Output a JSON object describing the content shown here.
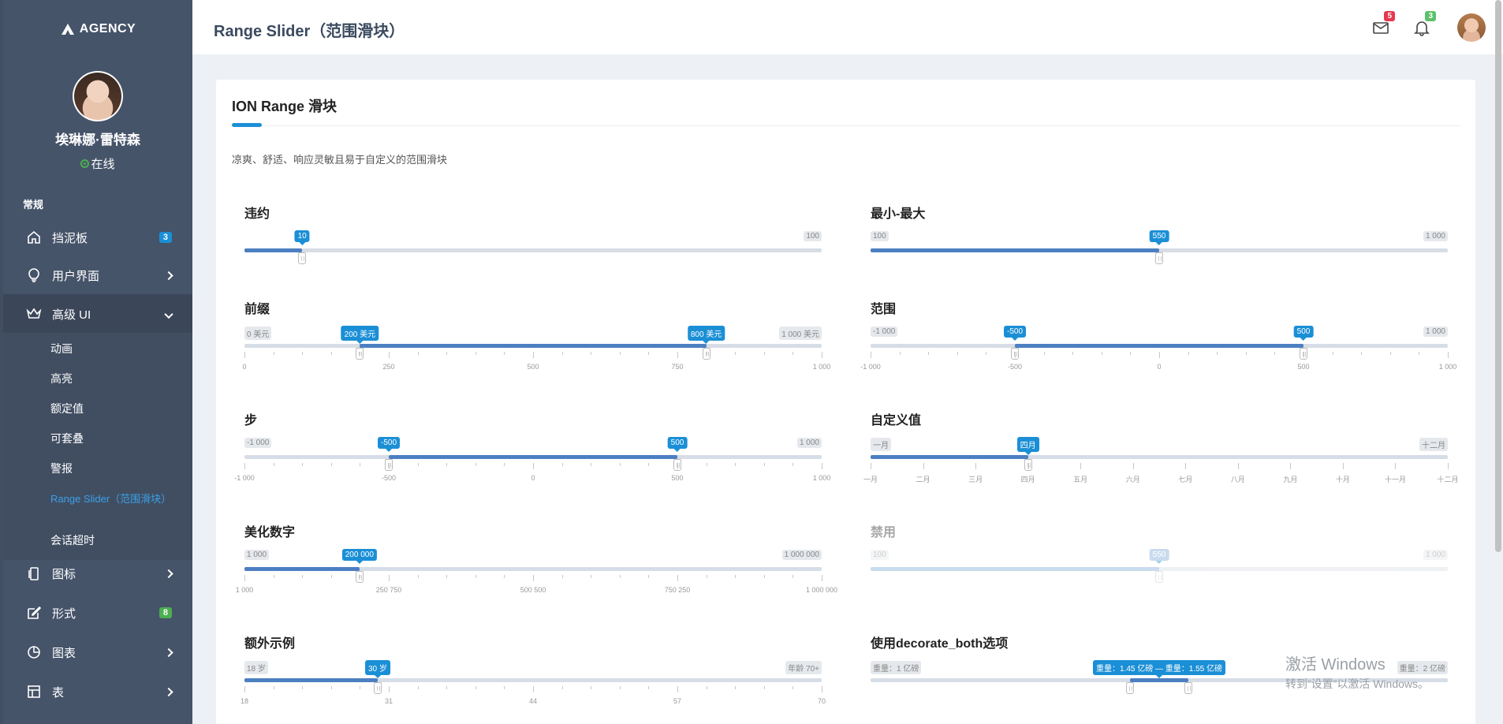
{
  "sidebar": {
    "logo": "AGENCY",
    "user_name": "埃琳娜·雷特森",
    "user_status": "在线",
    "section_general": "常规",
    "items": [
      {
        "label": "挡泥板",
        "badge": "3",
        "badge_color": "#1b8fd6"
      },
      {
        "label": "用户界面"
      },
      {
        "label": "高级 UI"
      },
      {
        "label": "图标"
      },
      {
        "label": "形式",
        "badge": "8",
        "badge_color": "#4caf50"
      },
      {
        "label": "图表"
      },
      {
        "label": "表"
      }
    ],
    "sub_items": [
      "动画",
      "高亮",
      "额定值",
      "可套叠",
      "警报",
      "Range Slider（范围滑块）",
      "会话超时"
    ]
  },
  "header": {
    "title": "Range Slider（范围滑块）",
    "mail_badge": "5",
    "bell_badge": "3"
  },
  "card": {
    "title": "ION Range 滑块",
    "description": "凉爽、舒适、响应灵敏且易于自定义的范围滑块"
  },
  "sliders": [
    {
      "title": "违约",
      "min_label": "",
      "max_label": "100",
      "values": [
        10
      ],
      "from_label": "10",
      "min": 0,
      "max": 100,
      "ticks": [],
      "tick_labels": []
    },
    {
      "title": "最小-最大",
      "min_label": "100",
      "max_label": "1 000",
      "values": [
        550
      ],
      "from_label": "550",
      "min": 100,
      "max": 1000,
      "ticks": [],
      "tick_labels": []
    },
    {
      "title": "前缀",
      "min_label": "0 美元",
      "max_label": "1 000 美元",
      "values": [
        200,
        800
      ],
      "from_label": "200 美元",
      "to_label": "800 美元",
      "min": 0,
      "max": 1000,
      "tick_labels": [
        "0",
        "250",
        "500",
        "750",
        "1 000"
      ]
    },
    {
      "title": "范围",
      "min_label": "-1 000",
      "max_label": "1 000",
      "values": [
        -500,
        500
      ],
      "from_label": "-500",
      "to_label": "500",
      "min": -1000,
      "max": 1000,
      "tick_labels": [
        "-1 000",
        "-500",
        "0",
        "500",
        "1 000"
      ]
    },
    {
      "title": "步",
      "min_label": "-1 000",
      "max_label": "1 000",
      "values": [
        -500,
        500
      ],
      "from_label": "-500",
      "to_label": "500",
      "min": -1000,
      "max": 1000,
      "tick_labels": [
        "-1 000",
        "-500",
        "0",
        "500",
        "1 000"
      ]
    },
    {
      "title": "自定义值",
      "min_label": "一月",
      "max_label": "十二月",
      "values": [
        3
      ],
      "from_label": "四月",
      "min": 0,
      "max": 11,
      "tick_labels": [
        "一月",
        "二月",
        "三月",
        "四月",
        "五月",
        "六月",
        "七月",
        "八月",
        "九月",
        "十月",
        "十一月",
        "十二月"
      ]
    },
    {
      "title": "美化数字",
      "min_label": "1 000",
      "max_label": "1 000 000",
      "values": [
        200000
      ],
      "from_label": "200 000",
      "min": 1000,
      "max": 1000000,
      "tick_labels": [
        "1 000",
        "250 750",
        "500 500",
        "750 250",
        "1 000 000"
      ]
    },
    {
      "title": "禁用",
      "min_label": "100",
      "max_label": "1 000",
      "values": [
        550
      ],
      "from_label": "550",
      "min": 100,
      "max": 1000,
      "tick_labels": [],
      "disabled": true
    },
    {
      "title": "额外示例",
      "min_label": "18 岁",
      "max_label": "年龄 70+",
      "values": [
        30
      ],
      "from_label": "30 岁",
      "min": 18,
      "max": 70,
      "tick_labels": [
        "18",
        "31",
        "44",
        "57",
        "70"
      ]
    },
    {
      "title": "使用decorate_both选项",
      "min_label": "重量：1 亿磅",
      "max_label": "重量：2 亿磅",
      "values": [
        1.45,
        1.55
      ],
      "from_label": "重量：1.45 亿磅 — 重量：1.55 亿磅",
      "combined": true,
      "min": 1,
      "max": 2,
      "tick_labels": []
    }
  ],
  "watermark": {
    "line1": "激活 Windows",
    "line2": "转到“设置”以激活 Windows。"
  }
}
